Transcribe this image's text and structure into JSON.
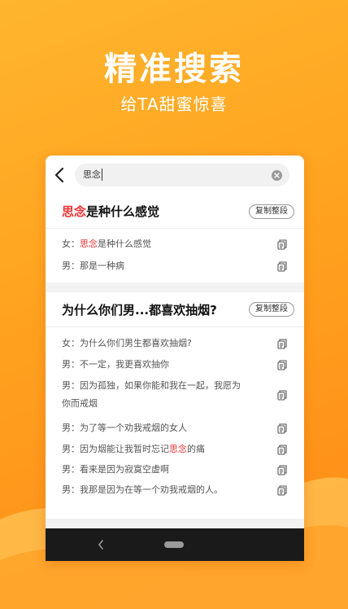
{
  "promo": {
    "headline": "精准搜索",
    "subline": "给TA甜蜜惊喜"
  },
  "search": {
    "value": "思念"
  },
  "sections": [
    {
      "title_highlight": "思念",
      "title_rest": "是种什么感觉",
      "copy_label": "复制整段",
      "lines": [
        {
          "prefix": "女：",
          "pre": "",
          "hl": "思念",
          "post": "是种什么感觉"
        },
        {
          "prefix": "男：",
          "pre": "那是一种病",
          "hl": "",
          "post": ""
        }
      ]
    },
    {
      "title_highlight": "",
      "title_rest": "为什么你们男...都喜欢抽烟?",
      "copy_label": "复制整段",
      "lines": [
        {
          "prefix": "女：",
          "pre": "为什么你们男生都喜欢抽烟?",
          "hl": "",
          "post": ""
        },
        {
          "prefix": "男：",
          "pre": "不一定，我更喜欢抽你",
          "hl": "",
          "post": ""
        },
        {
          "prefix": "男：",
          "pre": "因为孤独，如果你能和我在一起，我愿为",
          "hl": "",
          "post": ""
        },
        {
          "prefix": "",
          "pre": "你而戒烟",
          "hl": "",
          "post": ""
        },
        {
          "prefix": "男：",
          "pre": "为了等一个劝我戒烟的女人",
          "hl": "",
          "post": ""
        },
        {
          "prefix": "男：",
          "pre": "因为烟能让我暂时忘记",
          "hl": "思念",
          "post": "的痛"
        },
        {
          "prefix": "男：",
          "pre": "看来是因为寂寞空虚啊",
          "hl": "",
          "post": ""
        },
        {
          "prefix": "男：",
          "pre": "我那是因为在等一个劝我戒烟的人。",
          "hl": "",
          "post": ""
        }
      ]
    }
  ],
  "icons": {
    "back": "chevron-left-icon",
    "clear": "clear-icon",
    "copy": "copy-icon",
    "nav_back": "nav-back-icon",
    "nav_home": "nav-home-pill"
  },
  "colors": {
    "highlight": "#e33333",
    "orange_bg": "#ffa21f"
  }
}
